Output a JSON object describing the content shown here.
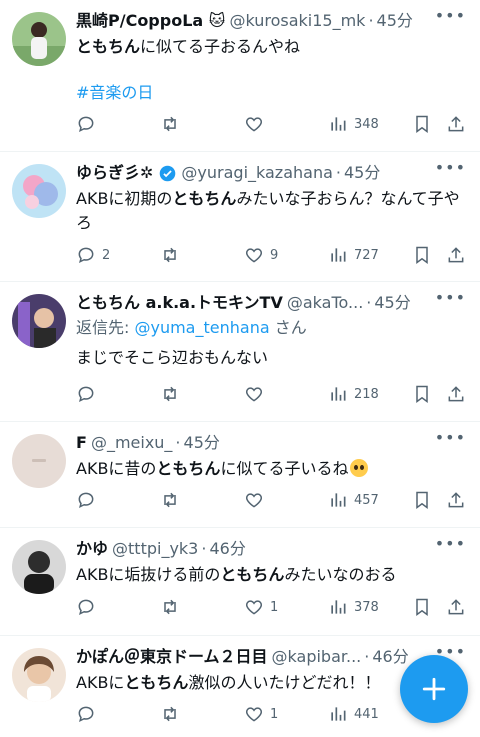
{
  "tweets": [
    {
      "name": "黒崎P/CoppoLa 🐱",
      "handle": "@kurosaki15_mk",
      "time": "45分",
      "segments": [
        [
          "",
          "ともちん"
        ],
        [
          "に似てる子おるんやね",
          ""
        ]
      ],
      "hashtag": "#音楽の日",
      "counts": {
        "reply": "",
        "retweet": "",
        "like": "",
        "views": "348"
      }
    },
    {
      "name": "ゆらぎ彡✲",
      "verified": true,
      "handle": "@yuragi_kazahana",
      "time": "45分",
      "segments": [
        [
          "AKBに初期の",
          ""
        ],
        [
          "",
          "ともちん"
        ],
        [
          "みたいな子おらん？なんて子やろ",
          ""
        ]
      ],
      "counts": {
        "reply": "2",
        "retweet": "",
        "like": "9",
        "views": "727"
      }
    },
    {
      "name": "ともちん a.k.a.トモキンTV",
      "handle": "@akaTo...",
      "time": "45分",
      "reply_to_label": "返信先: ",
      "reply_to_user": "@yuma_tenhana",
      "reply_to_suffix": " さん",
      "segments": [
        [
          "まじでそこら辺おもんない",
          ""
        ]
      ],
      "counts": {
        "reply": "",
        "retweet": "",
        "like": "",
        "views": "218"
      }
    },
    {
      "name": "F",
      "handle": "@_meixu_",
      "time": "45分",
      "segments": [
        [
          "AKBに昔の",
          ""
        ],
        [
          "",
          "ともちん"
        ],
        [
          "に似てる子いるね",
          ""
        ]
      ],
      "emoji": "pleading-face",
      "counts": {
        "reply": "",
        "retweet": "",
        "like": "",
        "views": "457"
      }
    },
    {
      "name": "かゆ",
      "handle": "@tttpi_yk3",
      "time": "46分",
      "segments": [
        [
          "AKBに垢抜ける前の",
          ""
        ],
        [
          "",
          "ともちん"
        ],
        [
          "みたいなのおる",
          ""
        ]
      ],
      "counts": {
        "reply": "",
        "retweet": "",
        "like": "1",
        "views": "378"
      }
    },
    {
      "name": "かぽん＠東京ドーム２日目",
      "handle": "@kapibar...",
      "time": "46分",
      "segments": [
        [
          "AKBに",
          ""
        ],
        [
          "",
          "ともちん"
        ],
        [
          "激似の人いたけどだれ！！",
          ""
        ]
      ],
      "counts": {
        "reply": "",
        "retweet": "",
        "like": "1",
        "views": "441"
      }
    }
  ],
  "colors": {
    "accent": "#1d9bf0",
    "muted": "#536471",
    "text": "#0f1419"
  },
  "fab": {
    "icon": "plus-icon"
  }
}
